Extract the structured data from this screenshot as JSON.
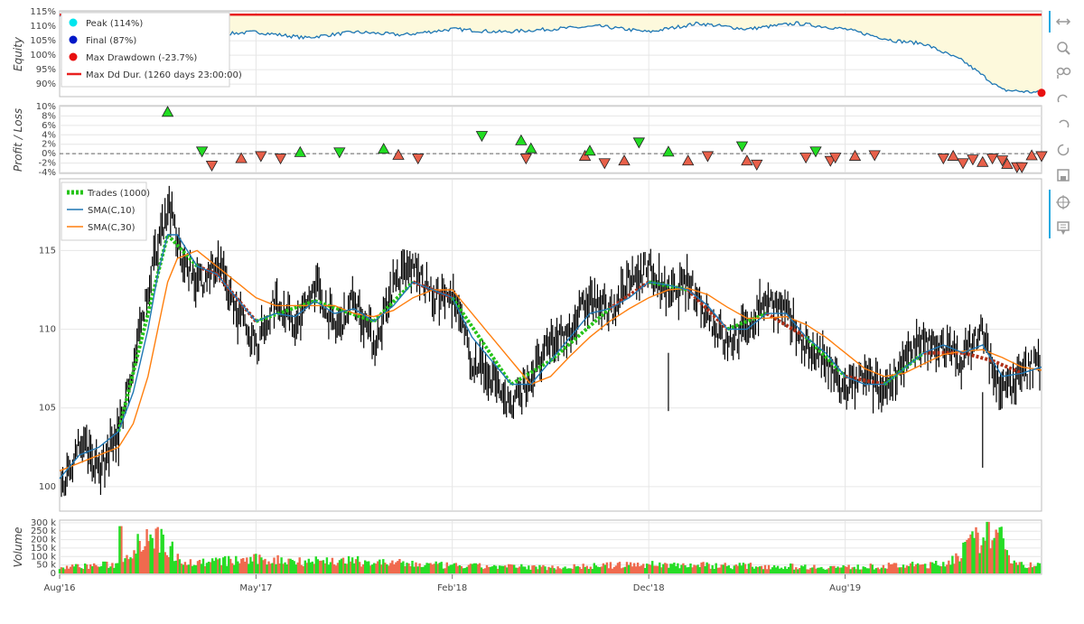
{
  "colors": {
    "equity_line": "#1f77b4",
    "equity_fill": "#fdf9dc",
    "dd_dur": "#e8201f",
    "peak": "#00e5ee",
    "final": "#0018c8",
    "maxdd": "#e81010",
    "win": "#22dd22",
    "loss": "#e8604a",
    "price": "#000000",
    "sma10": "#1f77b4",
    "sma30": "#ff7f0e",
    "trade_win": "#26c41a",
    "trade_loss": "#b03018",
    "vol_up": "#26dd26",
    "vol_down": "#f06a4e",
    "grid": "#e6e6e6"
  },
  "toolbar": {
    "icons": [
      "pan-icon",
      "box-zoom-icon",
      "wheel-zoom-icon",
      "undo-icon",
      "redo-icon",
      "reset-icon",
      "save-icon",
      "crosshair-icon",
      "hover-icon"
    ]
  },
  "chart_data": [
    {
      "type": "line",
      "panel": "equity",
      "ylabel": "Equity",
      "yticks": [
        "115%",
        "110%",
        "105%",
        "100%",
        "95%",
        "90%"
      ],
      "ylim": [
        86,
        115
      ],
      "legend": [
        {
          "label": "Peak (114%)",
          "marker": "circle",
          "color": "#00e5ee"
        },
        {
          "label": "Final (87%)",
          "marker": "circle",
          "color": "#0018c8"
        },
        {
          "label": "Max Drawdown (-23.7%)",
          "marker": "circle",
          "color": "#e81010"
        },
        {
          "label": "Max Dd Dur. (1260 days 23:00:00)",
          "marker": "line",
          "color": "#e8201f"
        }
      ],
      "legend_position": "top-left",
      "peak_value": 114,
      "final_value": 87,
      "max_drawdown": -23.7,
      "x": [
        0,
        0.05,
        0.1,
        0.15,
        0.2,
        0.25,
        0.3,
        0.35,
        0.4,
        0.45,
        0.5,
        0.55,
        0.6,
        0.65,
        0.7,
        0.75,
        0.8,
        0.85,
        0.88,
        0.9,
        0.92,
        0.94,
        0.96,
        0.98,
        1.0
      ],
      "values": [
        114,
        110,
        108,
        107,
        108,
        106,
        108,
        107,
        109,
        108,
        109,
        110,
        108,
        111,
        109,
        111,
        109,
        105,
        104,
        101,
        98,
        93,
        88,
        87.5,
        87
      ]
    },
    {
      "type": "scatter",
      "panel": "profit_loss",
      "ylabel": "Profit / Loss",
      "yticks": [
        "10%",
        "8%",
        "6%",
        "4%",
        "2%",
        "0%",
        "-2%",
        "-4%"
      ],
      "ylim": [
        -4,
        10
      ],
      "x": [
        0.11,
        0.145,
        0.155,
        0.185,
        0.205,
        0.225,
        0.245,
        0.285,
        0.33,
        0.345,
        0.365,
        0.43,
        0.47,
        0.475,
        0.48,
        0.535,
        0.54,
        0.555,
        0.575,
        0.59,
        0.62,
        0.64,
        0.66,
        0.695,
        0.7,
        0.71,
        0.76,
        0.77,
        0.785,
        0.79,
        0.81,
        0.83,
        0.9,
        0.91,
        0.92,
        0.93,
        0.94,
        0.95,
        0.96,
        0.965,
        0.975,
        0.98,
        0.99,
        1.0
      ],
      "values": [
        10.5,
        0.5,
        -2.5,
        -1.0,
        -0.5,
        -1.0,
        0.3,
        0.3,
        1.0,
        -0.3,
        -1.0,
        3.8,
        2.8,
        -1.0,
        1.1,
        -0.5,
        0.6,
        -2.0,
        -1.5,
        2.4,
        0.4,
        -1.5,
        -0.5,
        1.6,
        -1.5,
        -2.3,
        -0.8,
        0.5,
        -1.5,
        -0.8,
        -0.5,
        -0.3,
        -1.0,
        -0.5,
        -2.0,
        -1.2,
        -1.8,
        -1.0,
        -1.4,
        -2.2,
        -3.2,
        -3.0,
        -0.4,
        -0.5
      ]
    },
    {
      "type": "line",
      "panel": "price",
      "yticks": [
        "115",
        "110",
        "105",
        "100"
      ],
      "ylim": [
        98.5,
        119.5
      ],
      "legend": [
        {
          "label": "Trades (1000)",
          "marker": "dashed-line",
          "color": "#26c41a"
        },
        {
          "label": "SMA(C,10)",
          "marker": "line",
          "color": "#1f77b4"
        },
        {
          "label": "SMA(C,30)",
          "marker": "line",
          "color": "#ff7f0e"
        }
      ],
      "legend_position": "top-left",
      "x": [
        0,
        0.02,
        0.04,
        0.06,
        0.075,
        0.09,
        0.1,
        0.11,
        0.12,
        0.14,
        0.16,
        0.18,
        0.2,
        0.22,
        0.24,
        0.26,
        0.28,
        0.3,
        0.32,
        0.34,
        0.36,
        0.38,
        0.4,
        0.42,
        0.44,
        0.46,
        0.48,
        0.5,
        0.52,
        0.54,
        0.56,
        0.58,
        0.6,
        0.62,
        0.64,
        0.66,
        0.68,
        0.7,
        0.72,
        0.74,
        0.76,
        0.78,
        0.8,
        0.82,
        0.84,
        0.86,
        0.88,
        0.9,
        0.92,
        0.94,
        0.96,
        0.98,
        1.0
      ],
      "values": [
        100,
        103,
        101,
        104,
        108,
        113,
        116,
        118,
        115,
        113,
        114,
        111,
        109,
        112,
        110,
        113,
        110,
        112,
        109,
        113,
        114,
        112,
        112,
        108,
        107,
        105,
        107,
        109,
        110,
        112,
        111,
        113,
        114,
        112,
        113,
        111,
        109,
        110,
        112,
        111,
        109,
        108,
        106,
        107,
        106,
        108,
        109,
        109,
        108,
        110,
        106,
        107,
        108
      ],
      "sma10": [
        100.5,
        102,
        102.5,
        103.5,
        106,
        110,
        113.5,
        116,
        116,
        114,
        113.5,
        112,
        110.5,
        111,
        110.8,
        111.8,
        111,
        111.3,
        110.5,
        111.5,
        113,
        112.5,
        112,
        109.5,
        108,
        106.5,
        106.5,
        108,
        109.5,
        111,
        111.3,
        112,
        113,
        112.8,
        112.5,
        111.5,
        110,
        110,
        111,
        111,
        109.5,
        108.5,
        107,
        106.5,
        106.5,
        107.5,
        108.5,
        109,
        108.5,
        109,
        107,
        107.2,
        107.6
      ],
      "sma30": [
        101,
        101.5,
        102,
        102.5,
        104,
        107,
        110,
        113,
        114.5,
        115,
        114,
        113,
        112,
        111.5,
        111.5,
        111.5,
        111.5,
        111,
        110.8,
        111.2,
        112,
        112.5,
        112.5,
        111,
        109.5,
        108,
        106.5,
        107,
        108.3,
        109.5,
        110.5,
        111.3,
        112,
        112.5,
        112.6,
        112.2,
        111.4,
        110.7,
        110.7,
        110.8,
        110.3,
        109.5,
        108.5,
        107.5,
        107,
        107.2,
        107.8,
        108.4,
        108.6,
        108.7,
        108.2,
        107.6,
        107.4
      ]
    },
    {
      "type": "bar",
      "panel": "volume",
      "ylabel": "Volume",
      "yticks": [
        "300 k",
        "250 k",
        "200 k",
        "150 k",
        "100 k",
        "50 k",
        "0"
      ],
      "ylim": [
        0,
        310
      ],
      "xticks": [
        "Aug'16",
        "May'17",
        "Feb'18",
        "Dec'18",
        "Aug'19"
      ],
      "x": [
        0.0,
        0.06,
        0.09,
        0.13,
        0.2,
        0.3,
        0.4,
        0.5,
        0.6,
        0.7,
        0.8,
        0.9,
        0.92,
        0.94,
        0.95,
        0.96,
        0.97,
        0.98,
        1.0
      ],
      "values": [
        40,
        60,
        280,
        70,
        90,
        80,
        50,
        40,
        60,
        50,
        40,
        60,
        150,
        250,
        290,
        210,
        100,
        60,
        50
      ]
    }
  ]
}
